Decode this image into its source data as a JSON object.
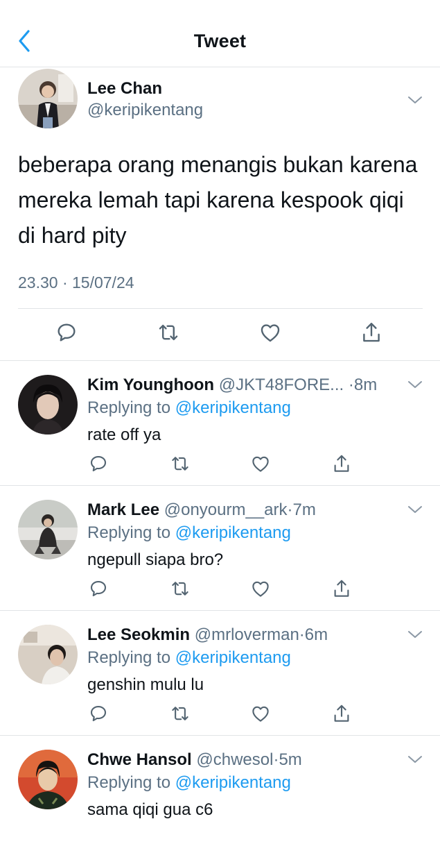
{
  "header": {
    "title": "Tweet"
  },
  "main_tweet": {
    "name": "Lee Chan",
    "handle": "@keripikentang",
    "text": "beberapa orang menangis bukan karena mereka lemah tapi karena kespook qiqi di hard pity",
    "timestamp": "23.30 · 15/07/24"
  },
  "replies": [
    {
      "name": "Kim Younghoon",
      "handle": "@JKT48FORE...",
      "dot": " ·",
      "time": "8m",
      "replying_prefix": "Replying to",
      "replying_to": "@keripikentang",
      "text": "rate off ya"
    },
    {
      "name": "Mark Lee",
      "handle": "@onyourm__ark",
      "dot": "·",
      "time": "7m",
      "replying_prefix": "Replying to",
      "replying_to": "@keripikentang",
      "text": "ngepull siapa bro?"
    },
    {
      "name": "Lee Seokmin",
      "handle": "@mrloverman",
      "dot": "·",
      "time": "6m",
      "replying_prefix": "Replying to",
      "replying_to": "@keripikentang",
      "text": "genshin mulu lu"
    },
    {
      "name": "Chwe Hansol",
      "handle": "@chwesol",
      "dot": "·",
      "time": "5m",
      "replying_prefix": "Replying to",
      "replying_to": "@keripikentang",
      "text": "sama qiqi gua c6"
    }
  ],
  "colors": {
    "accent": "#1d9bf0",
    "secondary_text": "#5b7083",
    "icon": "#536471",
    "divider": "#e1e4e6"
  },
  "icons": [
    "chevron-left-icon",
    "chevron-down-icon",
    "reply-icon",
    "retweet-icon",
    "like-icon",
    "share-icon"
  ]
}
